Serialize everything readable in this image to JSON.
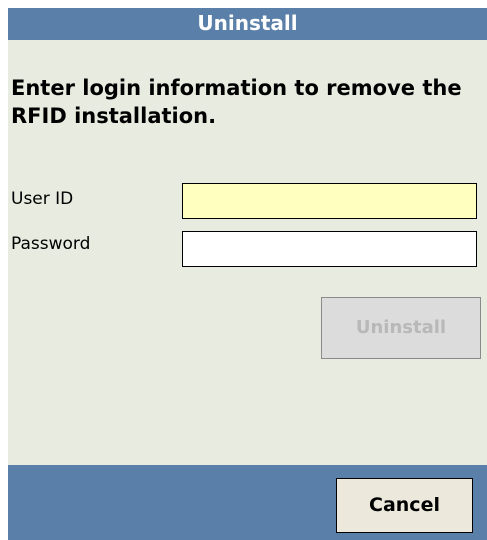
{
  "window": {
    "title": "Uninstall"
  },
  "message": "Enter login information to remove the RFID installation.",
  "form": {
    "user_id_label": "User ID",
    "user_id_value": "",
    "password_label": "Password",
    "password_value": ""
  },
  "buttons": {
    "uninstall_label": "Uninstall",
    "uninstall_enabled": false,
    "cancel_label": "Cancel"
  },
  "colors": {
    "titlebar": "#5a7fa8",
    "background": "#e8ebdf",
    "focused_field": "#ffffc0",
    "disabled_text": "#b8b8b8"
  }
}
